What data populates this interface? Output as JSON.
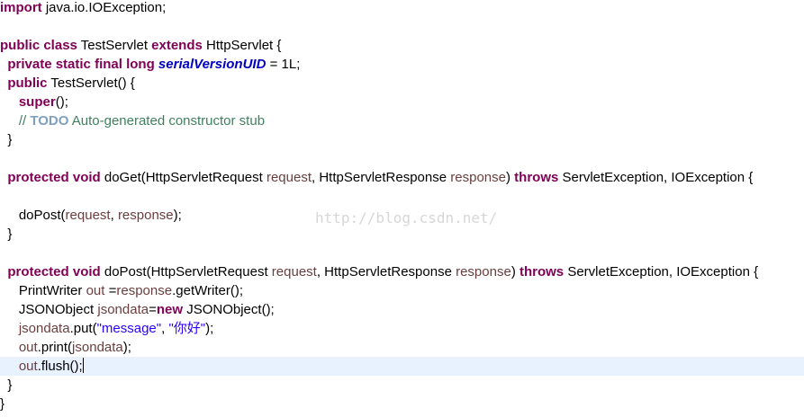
{
  "watermark": "http://blog.csdn.net/",
  "editor": {
    "current_line": 19,
    "lines": [
      [
        [
          "kw",
          "import"
        ],
        [
          "plain",
          " java.io.IOException;"
        ]
      ],
      [],
      [
        [
          "kw",
          "public"
        ],
        [
          "plain",
          " "
        ],
        [
          "kw",
          "class"
        ],
        [
          "plain",
          " TestServlet "
        ],
        [
          "kw",
          "extends"
        ],
        [
          "plain",
          " HttpServlet {"
        ]
      ],
      [
        [
          "plain",
          "  "
        ],
        [
          "kw",
          "private"
        ],
        [
          "plain",
          " "
        ],
        [
          "kw",
          "static"
        ],
        [
          "plain",
          " "
        ],
        [
          "kw",
          "final"
        ],
        [
          "plain",
          " "
        ],
        [
          "kw",
          "long"
        ],
        [
          "plain",
          " "
        ],
        [
          "field",
          "serialVersionUID"
        ],
        [
          "plain",
          " = 1L;"
        ]
      ],
      [
        [
          "plain",
          "  "
        ],
        [
          "kw",
          "public"
        ],
        [
          "plain",
          " TestServlet() {"
        ]
      ],
      [
        [
          "plain",
          "     "
        ],
        [
          "kw",
          "super"
        ],
        [
          "plain",
          "();"
        ]
      ],
      [
        [
          "cmt",
          "     // "
        ],
        [
          "todo",
          "TODO"
        ],
        [
          "cmt",
          " Auto-generated constructor stub"
        ]
      ],
      [
        [
          "plain",
          "  }"
        ]
      ],
      [],
      [
        [
          "plain",
          "  "
        ],
        [
          "kw",
          "protected"
        ],
        [
          "plain",
          " "
        ],
        [
          "kw",
          "void"
        ],
        [
          "plain",
          " doGet(HttpServletRequest "
        ],
        [
          "var",
          "request"
        ],
        [
          "plain",
          ", HttpServletResponse "
        ],
        [
          "var",
          "response"
        ],
        [
          "plain",
          ") "
        ],
        [
          "kw",
          "throws"
        ],
        [
          "plain",
          " ServletException, IOException {"
        ]
      ],
      [],
      [
        [
          "plain",
          "     doPost("
        ],
        [
          "var",
          "request"
        ],
        [
          "plain",
          ", "
        ],
        [
          "var",
          "response"
        ],
        [
          "plain",
          ");"
        ]
      ],
      [
        [
          "plain",
          "  }"
        ]
      ],
      [],
      [
        [
          "plain",
          "  "
        ],
        [
          "kw",
          "protected"
        ],
        [
          "plain",
          " "
        ],
        [
          "kw",
          "void"
        ],
        [
          "plain",
          " doPost(HttpServletRequest "
        ],
        [
          "var",
          "request"
        ],
        [
          "plain",
          ", HttpServletResponse "
        ],
        [
          "var",
          "response"
        ],
        [
          "plain",
          ") "
        ],
        [
          "kw",
          "throws"
        ],
        [
          "plain",
          " ServletException, IOException {"
        ]
      ],
      [
        [
          "plain",
          "     PrintWriter "
        ],
        [
          "var",
          "out"
        ],
        [
          "plain",
          " ="
        ],
        [
          "var",
          "response"
        ],
        [
          "plain",
          ".getWriter();"
        ]
      ],
      [
        [
          "plain",
          "     JSONObject "
        ],
        [
          "var",
          "jsondata"
        ],
        [
          "plain",
          "="
        ],
        [
          "kw",
          "new"
        ],
        [
          "plain",
          " JSONObject();"
        ]
      ],
      [
        [
          "plain",
          "     "
        ],
        [
          "var",
          "jsondata"
        ],
        [
          "plain",
          ".put("
        ],
        [
          "str",
          "\"message\""
        ],
        [
          "plain",
          ", "
        ],
        [
          "str",
          "\"你好\""
        ],
        [
          "plain",
          ");"
        ]
      ],
      [
        [
          "plain",
          "     "
        ],
        [
          "var",
          "out"
        ],
        [
          "plain",
          ".print("
        ],
        [
          "var",
          "jsondata"
        ],
        [
          "plain",
          ");"
        ]
      ],
      [
        [
          "plain",
          "     "
        ],
        [
          "var",
          "out"
        ],
        [
          "plain",
          ".flush();"
        ]
      ],
      [
        [
          "plain",
          "  }"
        ]
      ],
      [
        [
          "plain",
          "}"
        ]
      ]
    ]
  }
}
